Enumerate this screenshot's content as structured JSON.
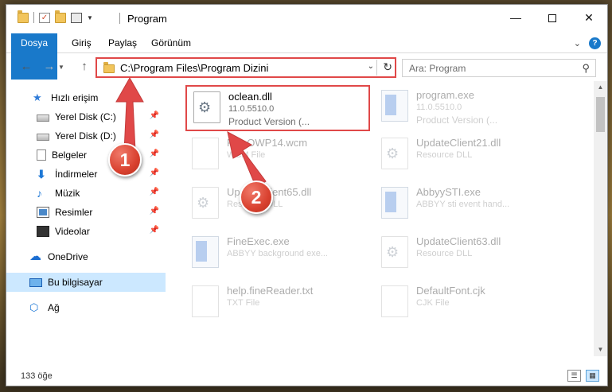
{
  "window": {
    "title": "Program",
    "min_glyph": "—",
    "close_glyph": "✕"
  },
  "ribbon": {
    "tabs": [
      "Dosya",
      "Giriş",
      "Paylaş",
      "Görünüm"
    ],
    "expand_glyph": "⌄",
    "help_glyph": "?"
  },
  "navbar": {
    "back_glyph": "←",
    "forward_glyph": "→",
    "dropdown_glyph": "▼",
    "up_glyph": "↑",
    "path": "C:\\Program Files\\Program Dizini",
    "chev_glyph": "⌄",
    "refresh_glyph": "↻",
    "search_placeholder": "Ara: Program",
    "search_glyph": "⚲"
  },
  "navpane": {
    "pin_glyph": "📌",
    "items": [
      {
        "label": "Hızlı erişim",
        "icon": "star-icon",
        "glyph": "★"
      },
      {
        "label": "Yerel Disk (C:)",
        "icon": "drive-icon"
      },
      {
        "label": "Yerel Disk (D:)",
        "icon": "drive-icon"
      },
      {
        "label": "Belgeler",
        "icon": "document-icon"
      },
      {
        "label": "İndirmeler",
        "icon": "download-icon",
        "glyph": "⬇"
      },
      {
        "label": "Müzik",
        "icon": "music-icon",
        "glyph": "♪"
      },
      {
        "label": "Resimler",
        "icon": "pictures-icon"
      },
      {
        "label": "Videolar",
        "icon": "video-icon"
      },
      {
        "label": "OneDrive",
        "icon": "cloud-icon",
        "glyph": "☁"
      },
      {
        "label": "Bu bilgisayar",
        "icon": "computer-icon",
        "selected": true
      },
      {
        "label": "Ağ",
        "icon": "network-icon",
        "glyph": "⬡"
      }
    ]
  },
  "files": [
    {
      "name": "oclean.dll",
      "line2": "11.0.5510.0",
      "line3": "Product Version   (...",
      "icon": "dll-icon",
      "highlighted": true
    },
    {
      "name": "program.exe",
      "line2": "11.0.5510.0",
      "line3": "Product Version   (...",
      "icon": "exe-icon"
    },
    {
      "name": "FineOWP14.wcm",
      "line2": "WCM File",
      "line3": "",
      "icon": "file-icon"
    },
    {
      "name": "UpdateClient21.dll",
      "line2": "Resource DLL",
      "line3": "",
      "icon": "dll-icon"
    },
    {
      "name": "UpdateClient65.dll",
      "line2": "Resource DLL",
      "line3": "",
      "icon": "dll-icon"
    },
    {
      "name": "AbbyySTI.exe",
      "line2": "ABBYY sti event hand...",
      "line3": "",
      "icon": "exe-icon"
    },
    {
      "name": "FineExec.exe",
      "line2": "ABBYY background exe...",
      "line3": "",
      "icon": "exe-icon"
    },
    {
      "name": "UpdateClient63.dll",
      "line2": "Resource DLL",
      "line3": "",
      "icon": "dll-icon"
    },
    {
      "name": "help.fineReader.txt",
      "line2": "TXT File",
      "line3": "",
      "icon": "text-file-icon"
    },
    {
      "name": "DefaultFont.cjk",
      "line2": "CJK File",
      "line3": "",
      "icon": "file-icon"
    }
  ],
  "scrollbar": {
    "up_glyph": "▲",
    "down_glyph": "▼"
  },
  "status": {
    "count": "133 öğe",
    "details_glyph": "☰",
    "tiles_glyph": "▦"
  },
  "annotations": {
    "badge1": "1",
    "badge2": "2",
    "color": "#e04848"
  }
}
